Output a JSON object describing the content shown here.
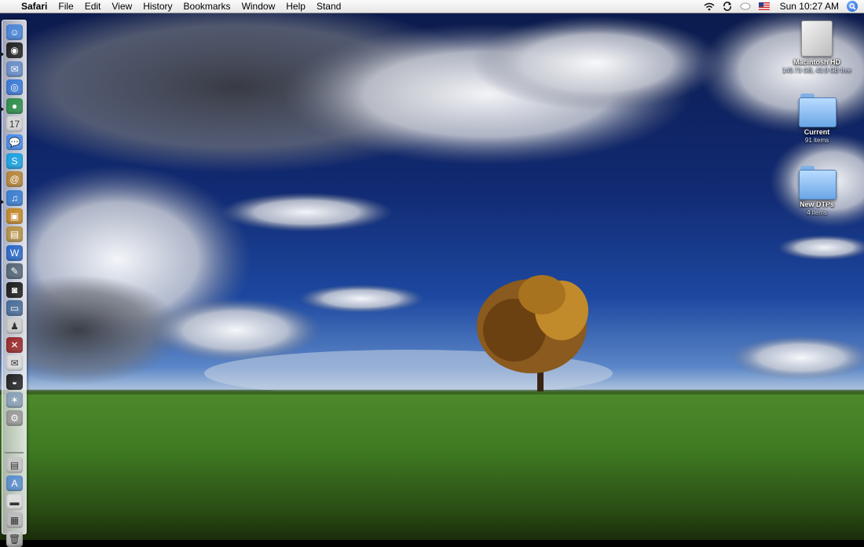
{
  "menubar": {
    "app_name": "Safari",
    "menus": [
      "File",
      "Edit",
      "View",
      "History",
      "Bookmarks",
      "Window",
      "Help",
      "Stand"
    ],
    "clock": "Sun 10:27 AM",
    "status_icons": [
      "wifi-icon",
      "sync-icon",
      "battery-icon",
      "us-flag-icon",
      "spotlight-icon"
    ]
  },
  "desktop": {
    "items": [
      {
        "label": "Macintosh HD",
        "sub": "149.73 GB, 43.9 GB free",
        "type": "hard-drive"
      },
      {
        "label": "Current",
        "sub": "91 items",
        "type": "folder"
      },
      {
        "label": "New DTPs",
        "sub": "4 items",
        "type": "folder"
      }
    ]
  },
  "dock": {
    "apps": [
      {
        "name": "finder-icon",
        "color": "#4a86d8",
        "glyph": "☺"
      },
      {
        "name": "dashboard-icon",
        "color": "#222222",
        "glyph": "◉"
      },
      {
        "name": "mail-icon",
        "color": "#6a8fc8",
        "glyph": "✉"
      },
      {
        "name": "safari-icon",
        "color": "#3d7ad6",
        "glyph": "◎"
      },
      {
        "name": "network-globe-icon",
        "color": "#2f8f4a",
        "glyph": "●"
      },
      {
        "name": "ical-icon",
        "color": "#d9d9d9",
        "glyph": "17"
      },
      {
        "name": "ichat-icon",
        "color": "#4a8ff0",
        "glyph": "💬"
      },
      {
        "name": "skype-icon",
        "color": "#1aa3e3",
        "glyph": "S"
      },
      {
        "name": "address-book-icon",
        "color": "#b8873a",
        "glyph": "@"
      },
      {
        "name": "itunes-icon",
        "color": "#3b7fd1",
        "glyph": "♫"
      },
      {
        "name": "iphoto-icon",
        "color": "#c58a2a",
        "glyph": "▣"
      },
      {
        "name": "preview-icon",
        "color": "#b89246",
        "glyph": "▤"
      },
      {
        "name": "word-icon",
        "color": "#2a68c7",
        "glyph": "W"
      },
      {
        "name": "pen-tool-icon",
        "color": "#556677",
        "glyph": "✎"
      },
      {
        "name": "photo-booth-icon",
        "color": "#1c1c1c",
        "glyph": "◙"
      },
      {
        "name": "monitor-icon",
        "color": "#4a6d9a",
        "glyph": "▭"
      },
      {
        "name": "stamp-icon",
        "color": "#cfcfcf",
        "glyph": "♟"
      },
      {
        "name": "disabled-app-icon",
        "color": "#9a2a2a",
        "glyph": "✕"
      },
      {
        "name": "notes-icon",
        "color": "#dcdcdc",
        "glyph": "✉"
      },
      {
        "name": "front-row-icon",
        "color": "#222222",
        "glyph": "◒"
      },
      {
        "name": "utility-icon",
        "color": "#8aa0b8",
        "glyph": "✶"
      },
      {
        "name": "system-prefs-icon",
        "color": "#9a9a9a",
        "glyph": "⚙"
      }
    ],
    "docs": [
      {
        "name": "stack-folder-icon",
        "color": "#c8c8c8",
        "glyph": "▤"
      },
      {
        "name": "applications-stack-icon",
        "color": "#5c8fd0",
        "glyph": "A"
      },
      {
        "name": "minimized-window-icon",
        "color": "#e0e0e0",
        "glyph": "▬"
      },
      {
        "name": "downloads-stack-icon",
        "color": "#bdbdbd",
        "glyph": "▦"
      },
      {
        "name": "trash-icon",
        "color": "#c8c8c8",
        "glyph": "🗑"
      }
    ]
  }
}
